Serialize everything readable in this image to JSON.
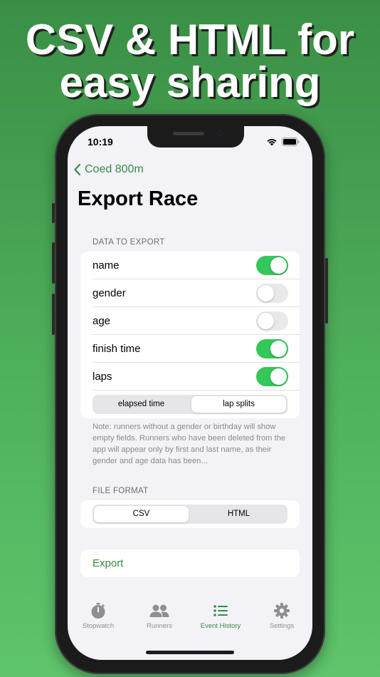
{
  "headline": {
    "line1": "CSV & HTML for",
    "line2": "easy sharing"
  },
  "status_bar": {
    "time": "10:19"
  },
  "nav": {
    "back_label": "Coed 800m",
    "title": "Export Race"
  },
  "data_section": {
    "header": "DATA TO EXPORT",
    "fields": [
      {
        "label": "name",
        "enabled": true
      },
      {
        "label": "gender",
        "enabled": false
      },
      {
        "label": "age",
        "enabled": false
      },
      {
        "label": "finish time",
        "enabled": true
      },
      {
        "label": "laps",
        "enabled": true
      }
    ],
    "lap_mode": {
      "options": [
        "elapsed time",
        "lap splits"
      ],
      "selected": "lap splits"
    },
    "note": "Note: runners without a gender or birthday will show empty fields. Runners who have been deleted from the app will appear only by first and last name, as their gender and age data has been..."
  },
  "format_section": {
    "header": "FILE FORMAT",
    "options": [
      "CSV",
      "HTML"
    ],
    "selected": "CSV"
  },
  "export_label": "Export",
  "tabs": [
    {
      "label": "Stopwatch",
      "icon": "stopwatch-icon",
      "active": false
    },
    {
      "label": "Runners",
      "icon": "runners-icon",
      "active": false
    },
    {
      "label": "Event History",
      "icon": "list-icon",
      "active": true
    },
    {
      "label": "Settings",
      "icon": "gear-icon",
      "active": false
    }
  ],
  "colors": {
    "accent": "#3a8a45",
    "toggle_on": "#34c759",
    "background": "#f2f2f7"
  }
}
